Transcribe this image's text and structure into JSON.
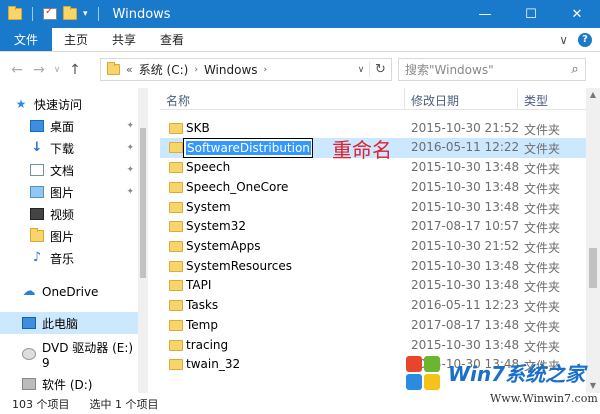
{
  "window": {
    "title": "Windows",
    "min": "—",
    "max": "☐",
    "close": "✕"
  },
  "ribbon": {
    "tabs": [
      "文件",
      "主页",
      "共享",
      "查看"
    ],
    "expand": "∨",
    "help": "?"
  },
  "address": {
    "back": "←",
    "forward": "→",
    "recent": "∨",
    "up": "↑",
    "chevron": "«",
    "segments": [
      "系统 (C:)",
      "Windows"
    ],
    "sep": "›",
    "dropdown": "∨",
    "refresh": "↻"
  },
  "search": {
    "placeholder": "搜索\"Windows\"",
    "icon": "⌕"
  },
  "nav": {
    "items": [
      {
        "label": "快速访问",
        "icon": "star-icon",
        "pinned": false
      },
      {
        "label": "桌面",
        "icon": "desktop-icon",
        "pinned": true
      },
      {
        "label": "下载",
        "icon": "download-icon",
        "pinned": true
      },
      {
        "label": "文档",
        "icon": "documents-icon",
        "pinned": true
      },
      {
        "label": "图片",
        "icon": "pictures-icon",
        "pinned": true
      },
      {
        "label": "视频",
        "icon": "video-icon",
        "pinned": false
      },
      {
        "label": "图片",
        "icon": "folder-icon",
        "pinned": false
      },
      {
        "label": "音乐",
        "icon": "music-icon",
        "pinned": false
      },
      {
        "label": "OneDrive",
        "icon": "onedrive-icon",
        "pinned": false
      },
      {
        "label": "此电脑",
        "icon": "this-pc-icon",
        "pinned": false
      },
      {
        "label": "DVD 驱动器 (E:) 9",
        "icon": "dvd-icon",
        "pinned": false
      },
      {
        "label": "软件 (D:)",
        "icon": "drive-icon",
        "pinned": false
      }
    ],
    "pin_glyph": "✦"
  },
  "columns": {
    "name": "名称",
    "date": "修改日期",
    "type": "类型",
    "sort": "^"
  },
  "files": [
    {
      "name": "SKB",
      "date": "2015-10-30 21:52",
      "type": "文件夹"
    },
    {
      "name": "SoftwareDistribution",
      "date": "2016-05-11 12:22",
      "type": "文件夹",
      "renaming": true
    },
    {
      "name": "Speech",
      "date": "2015-10-30 13:48",
      "type": "文件夹"
    },
    {
      "name": "Speech_OneCore",
      "date": "2015-10-30 13:48",
      "type": "文件夹"
    },
    {
      "name": "System",
      "date": "2015-10-30 13:48",
      "type": "文件夹"
    },
    {
      "name": "System32",
      "date": "2017-08-17 10:57",
      "type": "文件夹"
    },
    {
      "name": "SystemApps",
      "date": "2015-10-30 21:52",
      "type": "文件夹"
    },
    {
      "name": "SystemResources",
      "date": "2015-10-30 13:48",
      "type": "文件夹"
    },
    {
      "name": "TAPI",
      "date": "2015-10-30 13:48",
      "type": "文件夹"
    },
    {
      "name": "Tasks",
      "date": "2016-05-11 12:23",
      "type": "文件夹"
    },
    {
      "name": "Temp",
      "date": "2017-08-17 13:48",
      "type": "文件夹"
    },
    {
      "name": "tracing",
      "date": "2015-10-30 13:48",
      "type": "文件夹"
    },
    {
      "name": "twain_32",
      "date": "2015-10-30 13:48",
      "type": "文件夹"
    }
  ],
  "annotation": "重命名",
  "status": {
    "count": "103 个项目",
    "selected": "选中 1 个项目"
  },
  "watermark": {
    "title": "Win7系统之家",
    "url": "Www.Winwin7.com"
  },
  "colors": {
    "titlebar": "#1979ca",
    "selection": "#cce8ff",
    "annotation": "#e02030"
  }
}
